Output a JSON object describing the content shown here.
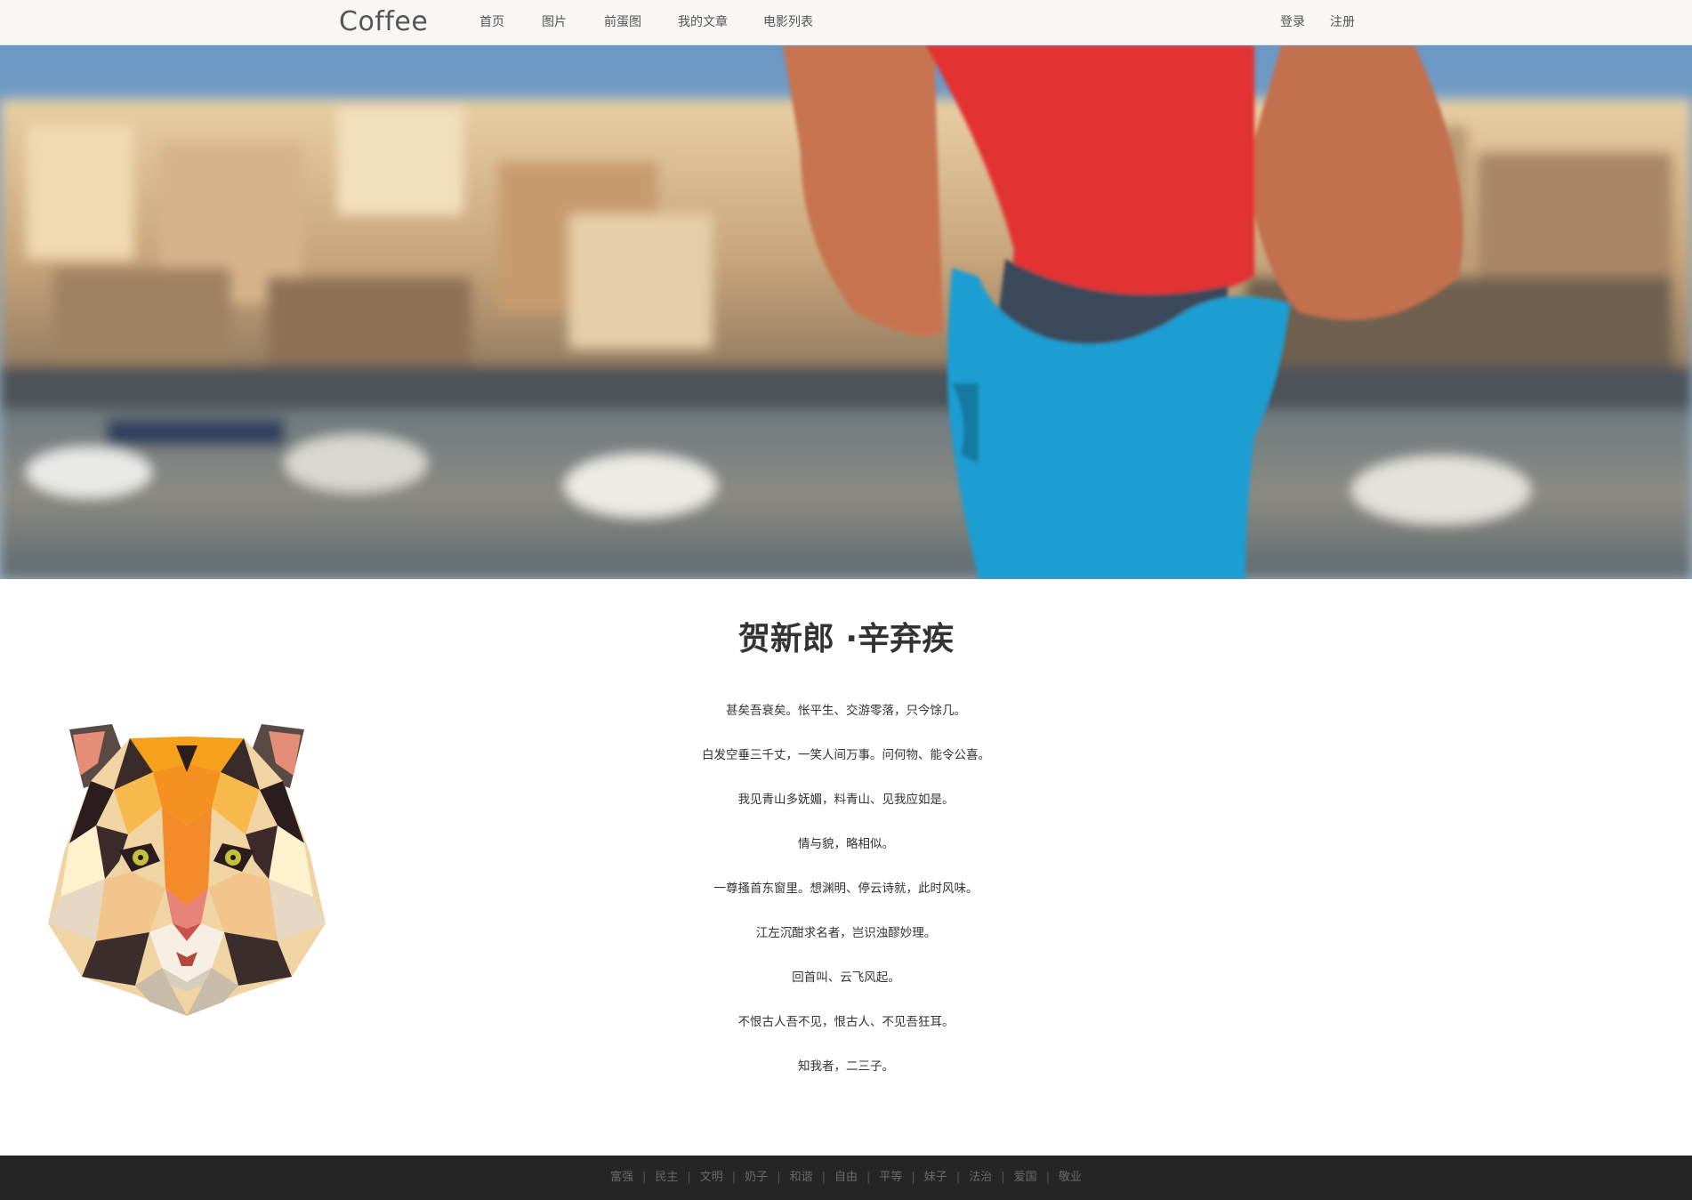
{
  "navbar": {
    "brand": "Coffee",
    "links": [
      {
        "label": "首页"
      },
      {
        "label": "图片"
      },
      {
        "label": "前蛋图"
      },
      {
        "label": "我的文章"
      },
      {
        "label": "电影列表"
      }
    ],
    "login": "登录",
    "register": "注册"
  },
  "hero": {
    "icon": "hero-photo-father-child-harbor"
  },
  "poem": {
    "title": "贺新郎 ·辛弃疾",
    "lines": [
      "甚矣吾衰矣。怅平生、交游零落，只今馀几。",
      "白发空垂三千丈，一笑人间万事。问何物、能令公喜。",
      "我见青山多妩媚，料青山、见我应如是。",
      "情与貌，略相似。",
      "一尊搔首东窗里。想渊明、停云诗就，此时风味。",
      "江左沉酣求名者，岂识浊醪妙理。",
      "回首叫、云飞风起。",
      "不恨古人吾不见，恨古人、不见吾狂耳。",
      "知我者，二三子。"
    ]
  },
  "side_image": {
    "icon": "low-poly-tiger-icon"
  },
  "footer": {
    "links": [
      "富强",
      "民主",
      "文明",
      "奶子",
      "和谐",
      "自由",
      "平等",
      "妹子",
      "法治",
      "爱国",
      "敬业"
    ],
    "separator": "|"
  },
  "colors": {
    "navbar_bg": "#f8f7f6",
    "footer_bg": "#252525",
    "footer_text": "#6a6a6a",
    "text": "#333333"
  }
}
